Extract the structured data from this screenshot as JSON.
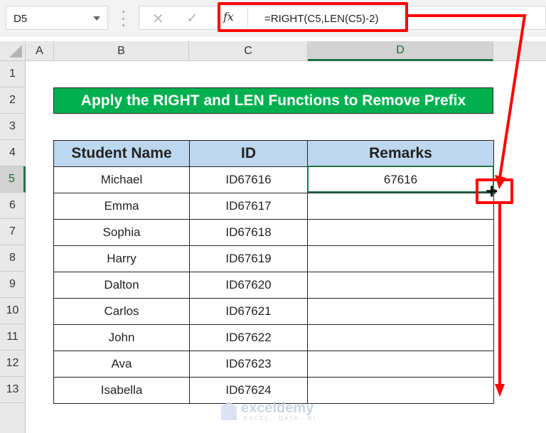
{
  "formula_bar": {
    "name_box": "D5",
    "cancel_icon": "✕",
    "enter_icon": "✓",
    "fx_label": "fx",
    "formula": "=RIGHT(C5,LEN(C5)-2)"
  },
  "columns": [
    "A",
    "B",
    "C",
    "D"
  ],
  "selected_column": "D",
  "rows": [
    "1",
    "2",
    "3",
    "4",
    "5",
    "6",
    "7",
    "8",
    "9",
    "10",
    "11",
    "12",
    "13"
  ],
  "selected_row": "5",
  "title": "Apply the RIGHT and LEN Functions to Remove Prefix",
  "table": {
    "headers": [
      "Student Name",
      "ID",
      "Remarks"
    ],
    "rows": [
      {
        "name": "Michael",
        "id": "ID67616",
        "remarks": "67616"
      },
      {
        "name": "Emma",
        "id": "ID67617",
        "remarks": ""
      },
      {
        "name": "Sophia",
        "id": "ID67618",
        "remarks": ""
      },
      {
        "name": "Harry",
        "id": "ID67619",
        "remarks": ""
      },
      {
        "name": "Dalton",
        "id": "ID67620",
        "remarks": ""
      },
      {
        "name": "Carlos",
        "id": "ID67621",
        "remarks": ""
      },
      {
        "name": "John",
        "id": "ID67622",
        "remarks": ""
      },
      {
        "name": "Ava",
        "id": "ID67623",
        "remarks": ""
      },
      {
        "name": "Isabella",
        "id": "ID67624",
        "remarks": ""
      }
    ]
  },
  "colors": {
    "accent_red": "#ff0000",
    "title_green": "#00b050",
    "header_blue": "#bdd7ee",
    "selection_green": "#217346"
  },
  "watermark": {
    "name": "exceldemy",
    "tagline": "EXCEL · DATA · BI"
  }
}
